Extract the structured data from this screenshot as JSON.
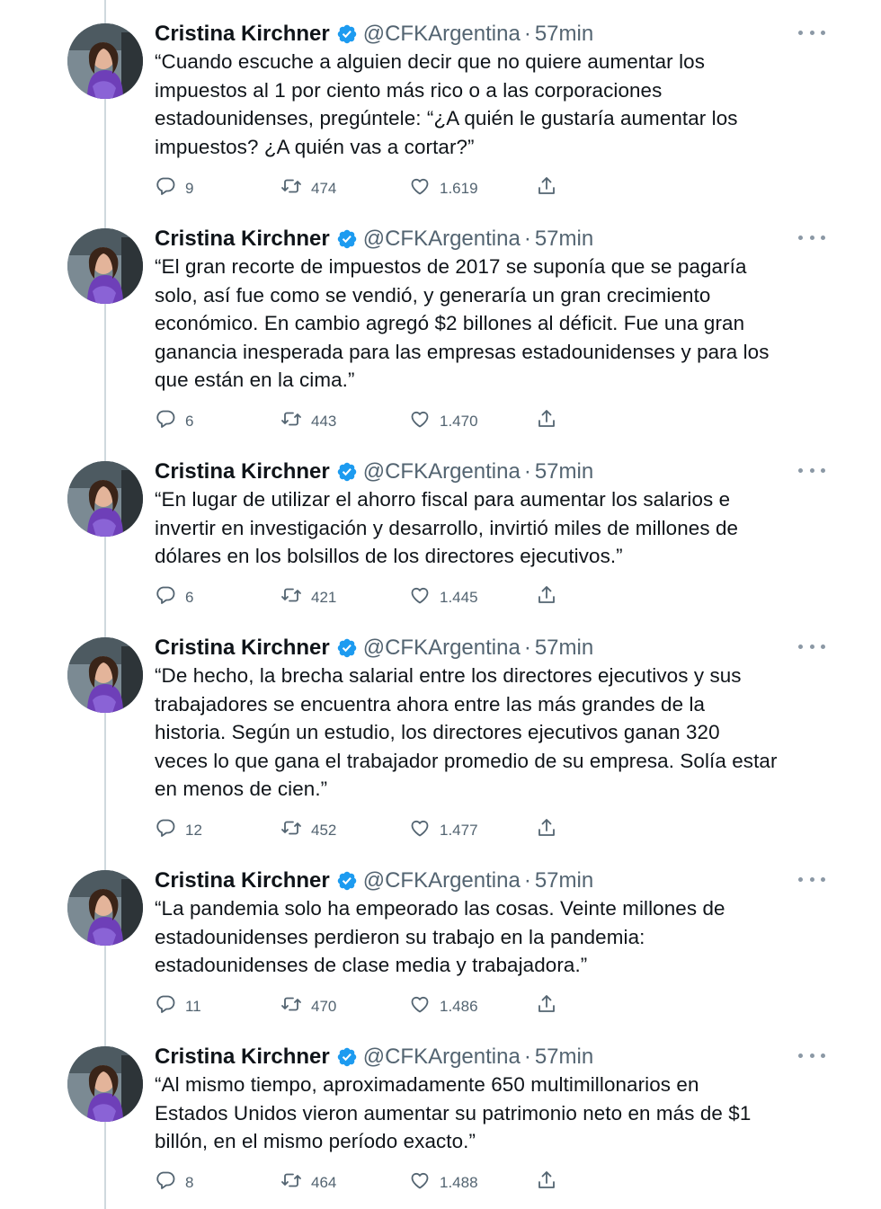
{
  "author": {
    "name": "Cristina Kirchner",
    "handle": "@CFKArgentina",
    "separator": "·"
  },
  "icons": {
    "verified": "verified-badge-icon",
    "reply": "reply-bubble-icon",
    "retweet": "retweet-icon",
    "like": "heart-icon",
    "share": "share-icon",
    "more": "more-dots-icon"
  },
  "colors": {
    "text": "#0f1419",
    "secondary": "#536471",
    "verified": "#1d9bf0",
    "thread_line": "#cfd9de"
  },
  "tweets": [
    {
      "time": "57min",
      "text": "“Cuando escuche a alguien decir que no quiere aumentar los\nimpuestos al 1 por ciento más rico o a las corporaciones\nestadounidenses, pregúntele: “¿A quién le gustaría aumentar los\nimpuestos? ¿A quién vas a cortar?”",
      "replies": "9",
      "retweets": "474",
      "likes": "1.619"
    },
    {
      "time": "57min",
      "text": "“El gran recorte de impuestos de 2017 se suponía que se pagaría\nsolo, así fue como se vendió, y generaría un gran crecimiento\neconómico. En cambio agregó $2 billones al déficit. Fue una gran\nganancia inesperada para las empresas estadounidenses y para los\nque están en la cima.”",
      "replies": "6",
      "retweets": "443",
      "likes": "1.470"
    },
    {
      "time": "57min",
      "text": "“En lugar de utilizar el ahorro fiscal para aumentar los salarios e\ninvertir en investigación y desarrollo, invirtió miles de millones de\ndólares en los bolsillos de los directores ejecutivos.”",
      "replies": "6",
      "retweets": "421",
      "likes": "1.445"
    },
    {
      "time": "57min",
      "text": "“De hecho, la brecha salarial entre los directores ejecutivos y sus\ntrabajadores se encuentra ahora entre las más grandes de la\nhistoria. Según un estudio, los directores ejecutivos ganan 320\nveces lo que gana el trabajador promedio de su empresa. Solía estar\nen menos de cien.”",
      "replies": "12",
      "retweets": "452",
      "likes": "1.477"
    },
    {
      "time": "57min",
      "text": "“La pandemia solo ha empeorado las cosas. Veinte millones de\nestadounidenses perdieron su trabajo en la pandemia:\nestadounidenses de clase media y trabajadora.”",
      "replies": "11",
      "retweets": "470",
      "likes": "1.486"
    },
    {
      "time": "57min",
      "text": "“Al mismo tiempo, aproximadamente 650 multimillonarios en\nEstados Unidos vieron aumentar su patrimonio neto en más de $1\nbillón, en el mismo período exacto.”",
      "replies": "8",
      "retweets": "464",
      "likes": "1.488"
    }
  ]
}
